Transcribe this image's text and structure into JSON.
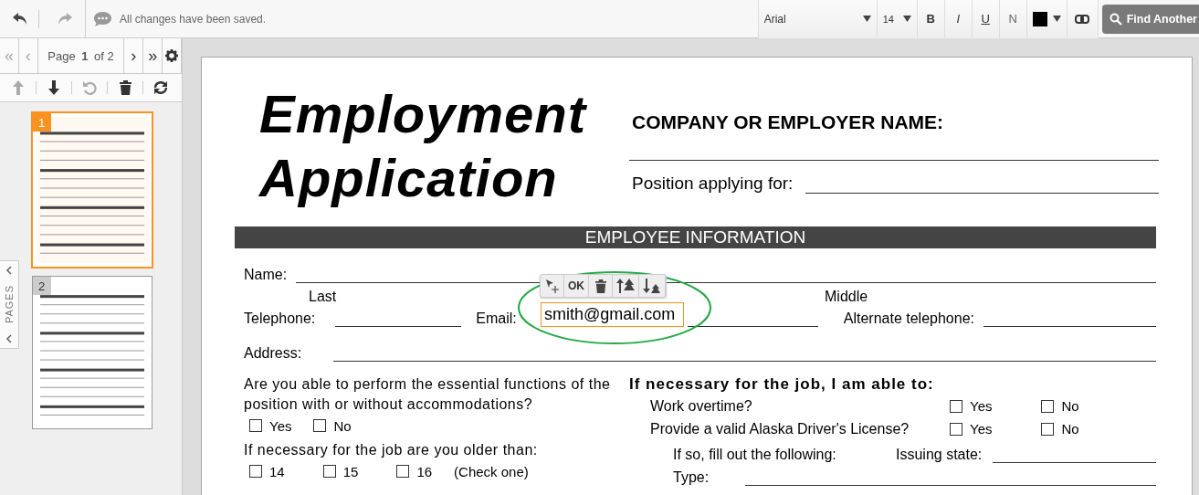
{
  "toolbar": {
    "status": "All changes have been saved.",
    "font": "Arial",
    "size": "14",
    "format_buttons": [
      {
        "kind": "bold",
        "label": "B"
      },
      {
        "kind": "italic",
        "label": "I"
      },
      {
        "kind": "underline",
        "label": "U"
      },
      {
        "kind": "normal",
        "label": "N"
      }
    ],
    "find_button": "Find Another"
  },
  "pager": {
    "first": "«",
    "previous": "‹",
    "label": "Page **1** of 2",
    "next": "›",
    "last": "»"
  },
  "pages_tab": "PAGES",
  "thumbnails": [
    {
      "number": "1",
      "selected": true
    },
    {
      "number": "2",
      "selected": false
    }
  ],
  "document": {
    "title_lines": [
      "Employment",
      "Application"
    ],
    "employer_label": "COMPANY OR EMPLOYER NAME:",
    "position_label": "Position applying for:",
    "section": "EMPLOYEE INFORMATION",
    "name_label": "Name:",
    "name_parts": [
      "Last",
      "Middle"
    ],
    "telephone_label": "Telephone:",
    "email_label": "Email:",
    "alt_phone_label": "Alternate telephone:",
    "address_label": "Address:",
    "question_1": "Are you able to perform the essential functions of the position with or without accommodations?",
    "question_1_options": [
      {
        "label": "Yes",
        "checked": false
      },
      {
        "label": "No",
        "checked": false
      }
    ],
    "question_2": "If necessary for the job are you older than:",
    "question_2_options": [
      {
        "label": "14",
        "checked": false
      },
      {
        "label": "15",
        "checked": false
      },
      {
        "label": "16",
        "checked": false
      }
    ],
    "question_2_note": "(Check one)",
    "abilities_heading": "If necessary for the job, I am able to:",
    "abilities": [
      {
        "label": "Work overtime?",
        "options": [
          {
            "label": "Yes",
            "checked": false
          },
          {
            "label": "No",
            "checked": false
          }
        ]
      },
      {
        "label": "Provide a valid Alaska Driver's License?",
        "options": [
          {
            "label": "Yes",
            "checked": false
          },
          {
            "label": "No",
            "checked": false
          }
        ]
      }
    ],
    "license_label": "If so, fill out the following:",
    "issuing_state_label": "Issuing state:",
    "type_label": "Type:"
  },
  "annotation": {
    "value": "smith@gmail.com",
    "ok_button": "OK"
  }
}
